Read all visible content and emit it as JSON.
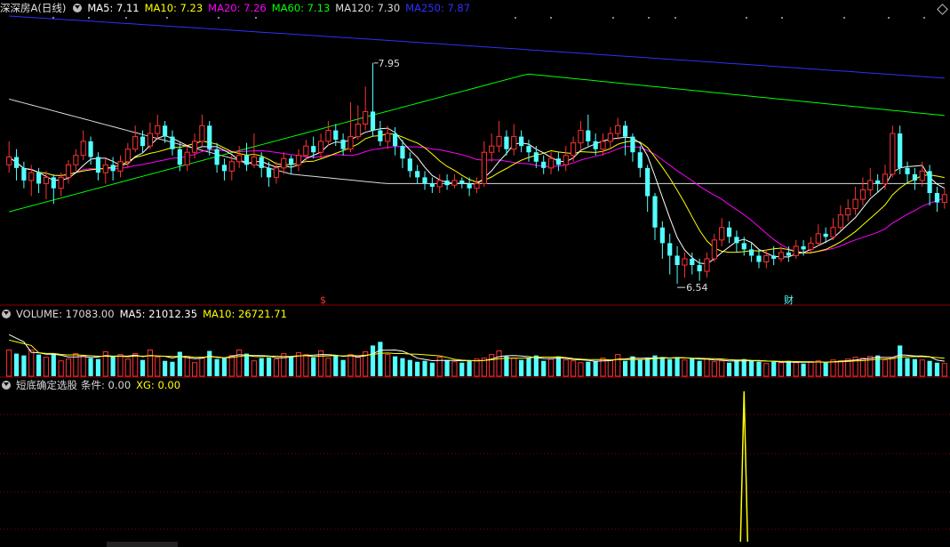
{
  "header": {
    "stock_name": "深深房A",
    "period": "(日线)",
    "ma_items": [
      {
        "label": "MA5: 7.11",
        "color": "#ffffff"
      },
      {
        "label": "MA10: 7.23",
        "color": "#ffff00"
      },
      {
        "label": "MA20: 7.26",
        "color": "#ff00ff"
      },
      {
        "label": "MA60: 7.13",
        "color": "#00ff00"
      },
      {
        "label": "MA120: 7.30",
        "color": "#dddddd"
      },
      {
        "label": "MA250: 7.87",
        "color": "#3030ff"
      }
    ]
  },
  "volume_header": {
    "label": "VOLUME: 17083.00",
    "ma5": "MA5: 21012.35",
    "ma10": "MA10: 26721.71"
  },
  "indicator_header": {
    "name": "短底确定选股",
    "cond": "条件: 0.00",
    "xg": "XG: 0.00"
  },
  "annotations": {
    "high": "7.95",
    "low": "6.54",
    "mark_s": "$",
    "mark_cai": "财"
  },
  "colors": {
    "up": "#ff3232",
    "down": "#54ffff",
    "ma5": "#ffffff",
    "ma10": "#ffff00",
    "ma20": "#ff00ff",
    "ma60": "#00ff00",
    "ma120": "#dddddd",
    "ma250": "#3030ff",
    "grid": "#8b0000",
    "signal": "#ffff00"
  },
  "chart_data": {
    "type": "candlestick",
    "y_range": [
      6.45,
      8.25
    ],
    "signal_index": 99,
    "candles": [
      [
        7.3,
        7.35,
        7.45,
        7.25
      ],
      [
        7.35,
        7.28,
        7.4,
        7.2
      ],
      [
        7.28,
        7.2,
        7.32,
        7.15
      ],
      [
        7.2,
        7.25,
        7.3,
        7.1
      ],
      [
        7.25,
        7.18,
        7.28,
        7.12
      ],
      [
        7.18,
        7.22,
        7.26,
        7.08
      ],
      [
        7.22,
        7.15,
        7.24,
        7.05
      ],
      [
        7.15,
        7.22,
        7.25,
        7.1
      ],
      [
        7.22,
        7.3,
        7.33,
        7.18
      ],
      [
        7.3,
        7.36,
        7.4,
        7.26
      ],
      [
        7.36,
        7.45,
        7.52,
        7.33
      ],
      [
        7.45,
        7.35,
        7.48,
        7.3
      ],
      [
        7.35,
        7.25,
        7.38,
        7.2
      ],
      [
        7.25,
        7.3,
        7.34,
        7.18
      ],
      [
        7.3,
        7.26,
        7.35,
        7.2
      ],
      [
        7.26,
        7.32,
        7.36,
        7.22
      ],
      [
        7.32,
        7.4,
        7.44,
        7.28
      ],
      [
        7.4,
        7.48,
        7.55,
        7.38
      ],
      [
        7.48,
        7.42,
        7.52,
        7.38
      ],
      [
        7.42,
        7.5,
        7.57,
        7.4
      ],
      [
        7.5,
        7.55,
        7.62,
        7.46
      ],
      [
        7.55,
        7.48,
        7.58,
        7.44
      ],
      [
        7.48,
        7.4,
        7.52,
        7.36
      ],
      [
        7.4,
        7.3,
        7.44,
        7.26
      ],
      [
        7.3,
        7.38,
        7.42,
        7.26
      ],
      [
        7.38,
        7.45,
        7.5,
        7.34
      ],
      [
        7.45,
        7.55,
        7.62,
        7.42
      ],
      [
        7.55,
        7.4,
        7.58,
        7.36
      ],
      [
        7.4,
        7.3,
        7.44,
        7.25
      ],
      [
        7.3,
        7.26,
        7.34,
        7.2
      ],
      [
        7.26,
        7.32,
        7.36,
        7.2
      ],
      [
        7.32,
        7.36,
        7.42,
        7.28
      ],
      [
        7.36,
        7.3,
        7.44,
        7.26
      ],
      [
        7.3,
        7.35,
        7.5,
        7.28
      ],
      [
        7.35,
        7.28,
        7.38,
        7.22
      ],
      [
        7.28,
        7.22,
        7.32,
        7.16
      ],
      [
        7.22,
        7.28,
        7.32,
        7.18
      ],
      [
        7.28,
        7.34,
        7.38,
        7.24
      ],
      [
        7.34,
        7.3,
        7.36,
        7.24
      ],
      [
        7.3,
        7.36,
        7.4,
        7.26
      ],
      [
        7.36,
        7.42,
        7.46,
        7.32
      ],
      [
        7.42,
        7.38,
        7.48,
        7.34
      ],
      [
        7.38,
        7.45,
        7.5,
        7.34
      ],
      [
        7.45,
        7.52,
        7.58,
        7.42
      ],
      [
        7.52,
        7.46,
        7.56,
        7.42
      ],
      [
        7.46,
        7.4,
        7.5,
        7.36
      ],
      [
        7.4,
        7.48,
        7.7,
        7.38
      ],
      [
        7.48,
        7.56,
        7.68,
        7.46
      ],
      [
        7.56,
        7.64,
        7.8,
        7.52
      ],
      [
        7.64,
        7.52,
        7.95,
        7.48
      ],
      [
        7.52,
        7.45,
        7.58,
        7.42
      ],
      [
        7.45,
        7.5,
        7.55,
        7.4
      ],
      [
        7.5,
        7.42,
        7.54,
        7.36
      ],
      [
        7.42,
        7.34,
        7.46,
        7.28
      ],
      [
        7.34,
        7.26,
        7.38,
        7.22
      ],
      [
        7.26,
        7.22,
        7.3,
        7.18
      ],
      [
        7.22,
        7.18,
        7.26,
        7.14
      ],
      [
        7.18,
        7.16,
        7.22,
        7.12
      ],
      [
        7.16,
        7.2,
        7.24,
        7.12
      ],
      [
        7.2,
        7.17,
        7.24,
        7.14
      ],
      [
        7.17,
        7.2,
        7.24,
        7.15
      ],
      [
        7.2,
        7.18,
        7.22,
        7.15
      ],
      [
        7.18,
        7.15,
        7.22,
        7.1
      ],
      [
        7.15,
        7.18,
        7.22,
        7.12
      ],
      [
        7.18,
        7.38,
        7.45,
        7.16
      ],
      [
        7.38,
        7.42,
        7.5,
        7.32
      ],
      [
        7.42,
        7.48,
        7.58,
        7.38
      ],
      [
        7.48,
        7.4,
        7.52,
        7.36
      ],
      [
        7.4,
        7.48,
        7.56,
        7.36
      ],
      [
        7.48,
        7.42,
        7.52,
        7.38
      ],
      [
        7.42,
        7.38,
        7.46,
        7.32
      ],
      [
        7.38,
        7.32,
        7.42,
        7.28
      ],
      [
        7.32,
        7.28,
        7.36,
        7.24
      ],
      [
        7.28,
        7.34,
        7.38,
        7.24
      ],
      [
        7.34,
        7.3,
        7.38,
        7.26
      ],
      [
        7.3,
        7.36,
        7.42,
        7.26
      ],
      [
        7.36,
        7.44,
        7.48,
        7.32
      ],
      [
        7.44,
        7.52,
        7.58,
        7.4
      ],
      [
        7.52,
        7.45,
        7.62,
        7.42
      ],
      [
        7.45,
        7.4,
        7.5,
        7.36
      ],
      [
        7.4,
        7.45,
        7.5,
        7.36
      ],
      [
        7.45,
        7.5,
        7.54,
        7.4
      ],
      [
        7.5,
        7.55,
        7.6,
        7.46
      ],
      [
        7.55,
        7.48,
        7.58,
        7.36
      ],
      [
        7.48,
        7.38,
        7.5,
        7.32
      ],
      [
        7.38,
        7.28,
        7.42,
        7.22
      ],
      [
        7.28,
        7.1,
        7.3,
        7.0
      ],
      [
        7.1,
        6.9,
        7.12,
        6.82
      ],
      [
        6.9,
        6.8,
        6.94,
        6.7
      ],
      [
        6.8,
        6.72,
        6.86,
        6.6
      ],
      [
        6.72,
        6.66,
        6.78,
        6.54
      ],
      [
        6.66,
        6.7,
        6.74,
        6.58
      ],
      [
        6.7,
        6.66,
        6.74,
        6.6
      ],
      [
        6.66,
        6.62,
        6.7,
        6.56
      ],
      [
        6.62,
        6.7,
        6.74,
        6.58
      ],
      [
        6.7,
        6.82,
        6.86,
        6.68
      ],
      [
        6.82,
        6.9,
        6.96,
        6.78
      ],
      [
        6.9,
        6.84,
        6.94,
        6.8
      ],
      [
        6.84,
        6.8,
        6.88,
        6.74
      ],
      [
        6.8,
        6.76,
        6.84,
        6.72
      ],
      [
        6.76,
        6.72,
        6.8,
        6.68
      ],
      [
        6.72,
        6.68,
        6.76,
        6.64
      ],
      [
        6.68,
        6.72,
        6.76,
        6.64
      ],
      [
        6.72,
        6.7,
        6.78,
        6.66
      ],
      [
        6.7,
        6.74,
        6.78,
        6.68
      ],
      [
        6.74,
        6.72,
        6.78,
        6.68
      ],
      [
        6.72,
        6.78,
        6.82,
        6.7
      ],
      [
        6.78,
        6.76,
        6.82,
        6.72
      ],
      [
        6.76,
        6.8,
        6.84,
        6.74
      ],
      [
        6.8,
        6.86,
        6.92,
        6.78
      ],
      [
        6.86,
        6.84,
        6.9,
        6.8
      ],
      [
        6.84,
        6.9,
        6.96,
        6.82
      ],
      [
        6.9,
        6.98,
        7.04,
        6.88
      ],
      [
        6.98,
        7.02,
        7.08,
        6.94
      ],
      [
        7.02,
        7.08,
        7.16,
        6.98
      ],
      [
        7.08,
        7.14,
        7.22,
        7.04
      ],
      [
        7.14,
        7.2,
        7.28,
        7.1
      ],
      [
        7.2,
        7.18,
        7.24,
        7.12
      ],
      [
        7.18,
        7.24,
        7.3,
        7.14
      ],
      [
        7.24,
        7.5,
        7.55,
        7.22
      ],
      [
        7.5,
        7.28,
        7.55,
        7.24
      ],
      [
        7.28,
        7.24,
        7.32,
        7.18
      ],
      [
        7.24,
        7.2,
        7.28,
        7.14
      ],
      [
        7.2,
        7.26,
        7.32,
        7.16
      ],
      [
        7.26,
        7.12,
        7.3,
        7.04
      ],
      [
        7.12,
        7.06,
        7.16,
        7.0
      ],
      [
        7.06,
        7.11,
        7.15,
        7.02
      ]
    ],
    "volumes": [
      29,
      25,
      23,
      29,
      24,
      21,
      25,
      17,
      19,
      25,
      23,
      20,
      19,
      27,
      22,
      24,
      19,
      25,
      18,
      29,
      21,
      17,
      16,
      27,
      22,
      15,
      20,
      28,
      19,
      20,
      23,
      29,
      25,
      17,
      20,
      21,
      19,
      25,
      21,
      26,
      24,
      21,
      28,
      20,
      23,
      18,
      24,
      21,
      27,
      34,
      38,
      24,
      22,
      20,
      18,
      16,
      17,
      15,
      21,
      18,
      16,
      15,
      17,
      19,
      20,
      24,
      28,
      22,
      20,
      18,
      20,
      23,
      17,
      19,
      22,
      18,
      17,
      15,
      16,
      17,
      20,
      18,
      24,
      17,
      22,
      18,
      20,
      23,
      21,
      19,
      21,
      18,
      20,
      17,
      19,
      16,
      17,
      15,
      18,
      19,
      17,
      16,
      14,
      16,
      15,
      17,
      15,
      14,
      16,
      17,
      15,
      18,
      17,
      19,
      21,
      20,
      22,
      23,
      18,
      21,
      34,
      20,
      19,
      18,
      17,
      15,
      14
    ],
    "vol_max": 60
  }
}
